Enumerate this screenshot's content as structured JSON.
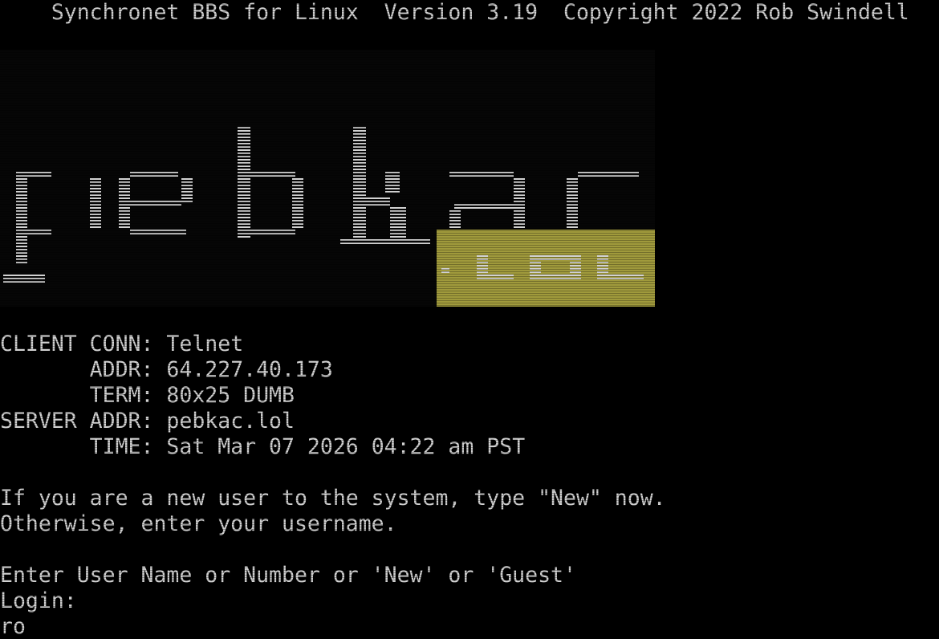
{
  "header": {
    "title": "    Synchronet BBS for Linux  Version 3.19  Copyright 2022 Rob Swindell"
  },
  "logo": {
    "text": "pebkac",
    "tld": ".lol",
    "primary_color": "#5fbe4a",
    "tld_bg_color": "#a09a3c",
    "tld_fg_color": "#e6dd8a"
  },
  "connection": {
    "client_conn_label": "CLIENT CONN:",
    "client_conn_value": "Telnet",
    "addr_label": "       ADDR:",
    "addr_value": "64.227.40.173",
    "term_label": "       TERM:",
    "term_value": "80x25 DUMB",
    "server_addr_label": "SERVER ADDR:",
    "server_addr_value": "pebkac.lol",
    "time_label": "       TIME:",
    "time_value": "Sat Mar 07 2026 04:22 am PST"
  },
  "prompts": {
    "new_user_line": "If you are a new user to the system, type \"New\" now.",
    "otherwise_line": "Otherwise, enter your username.",
    "enter_line": "Enter User Name or Number or 'New' or 'Guest'",
    "login_label": "Login:",
    "login_input": "ro"
  }
}
